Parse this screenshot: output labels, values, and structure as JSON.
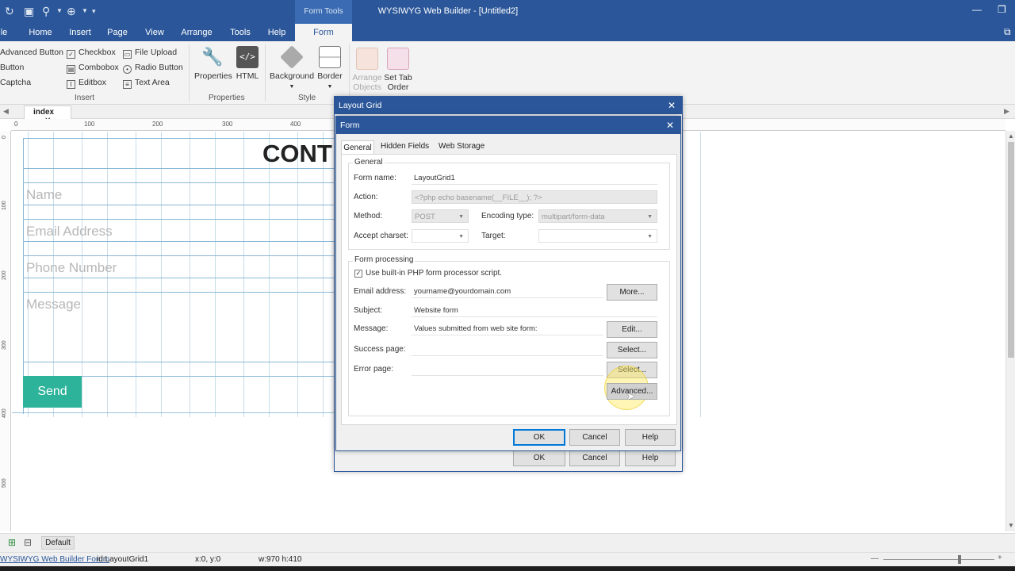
{
  "app": {
    "title": "WYSIWYG Web Builder - [Untitled2]",
    "context_tab": "Form Tools"
  },
  "ribbon_tabs": [
    "le",
    "Home",
    "Insert",
    "Page",
    "View",
    "Arrange",
    "Tools",
    "Help",
    "Form"
  ],
  "ribbon": {
    "insert_items": {
      "col1": [
        "Advanced Button",
        "Button",
        "Captcha"
      ],
      "col2": [
        "Checkbox",
        "Combobox",
        "Editbox"
      ],
      "col3": [
        "File Upload",
        "Radio Button",
        "Text Area"
      ]
    },
    "groups": {
      "insert": "Insert",
      "properties": "Properties",
      "style": "Style"
    },
    "buttons": {
      "properties": "Properties",
      "html": "HTML",
      "background": "Background",
      "border": "Border",
      "arrange_objects_1": "Arrange",
      "arrange_objects_2": "Objects",
      "set_tab_1": "Set Tab",
      "set_tab_2": "Order"
    }
  },
  "doc_tab": "index",
  "ruler": {
    "h": [
      "0",
      "100",
      "200",
      "300",
      "400"
    ],
    "v": [
      "0",
      "100",
      "200",
      "300",
      "400",
      "500"
    ]
  },
  "canvas": {
    "heading": "CONT",
    "placeholders": {
      "name": "Name",
      "email": "Email Address",
      "phone": "Phone Number",
      "message": "Message"
    },
    "send_button": "Send",
    "send_color": "#2db39a"
  },
  "statusbar": {
    "layer": "Default",
    "forum_link": "WYSIWYG Web Builder Forum",
    "id": "id:LayoutGrid1",
    "coords": "x:0, y:0",
    "size": "w:970 h:410"
  },
  "layout_grid_dialog": {
    "title": "Layout Grid",
    "ok": "OK",
    "cancel": "Cancel",
    "help": "Help"
  },
  "form_dialog": {
    "title": "Form",
    "tabs": [
      "General",
      "Hidden Fields",
      "Web Storage"
    ],
    "general_group": "General",
    "form_name_label": "Form name:",
    "form_name": "LayoutGrid1",
    "action_label": "Action:",
    "action": "<?php echo basename(__FILE__); ?>",
    "method_label": "Method:",
    "method": "POST",
    "encoding_label": "Encoding type:",
    "encoding": "multipart/form-data",
    "charset_label": "Accept charset:",
    "charset": "",
    "target_label": "Target:",
    "target": "",
    "processing_group": "Form processing",
    "use_builtin": "Use built-in PHP form processor script.",
    "email_label": "Email address:",
    "email": "yourname@yourdomain.com",
    "more_btn": "More...",
    "subject_label": "Subject:",
    "subject": "Website form",
    "message_label": "Message:",
    "message": "Values submitted from web site form:",
    "edit_btn": "Edit...",
    "success_label": "Success page:",
    "success": "",
    "select_btn": "Select...",
    "error_label": "Error page:",
    "error": "",
    "advanced_btn": "Advanced...",
    "ok": "OK",
    "cancel": "Cancel",
    "help": "Help"
  }
}
